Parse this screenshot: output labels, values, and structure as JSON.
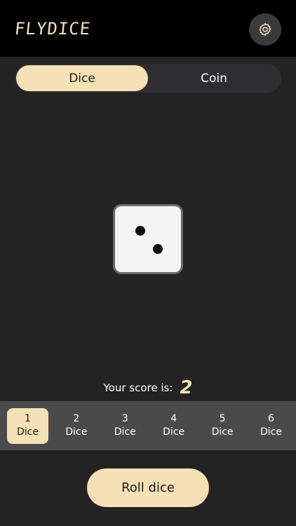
{
  "app": {
    "title": "FLYDICE"
  },
  "header": {
    "settings_icon": "gear-icon"
  },
  "tabs": [
    {
      "label": "Dice",
      "active": true
    },
    {
      "label": "Coin",
      "active": false
    }
  ],
  "die": {
    "face": 2
  },
  "score": {
    "label": "Your score is:",
    "value": "2"
  },
  "dice_count": {
    "selected": 1,
    "options": [
      {
        "number": "1",
        "label": "Dice"
      },
      {
        "number": "2",
        "label": "Dice"
      },
      {
        "number": "3",
        "label": "Dice"
      },
      {
        "number": "4",
        "label": "Dice"
      },
      {
        "number": "5",
        "label": "Dice"
      },
      {
        "number": "6",
        "label": "Dice"
      }
    ]
  },
  "roll_button": {
    "label": "Roll dice"
  },
  "colors": {
    "accent": "#f5e1b5",
    "background": "#232323",
    "header": "#000000",
    "selector_bar": "#4a4a4a"
  }
}
